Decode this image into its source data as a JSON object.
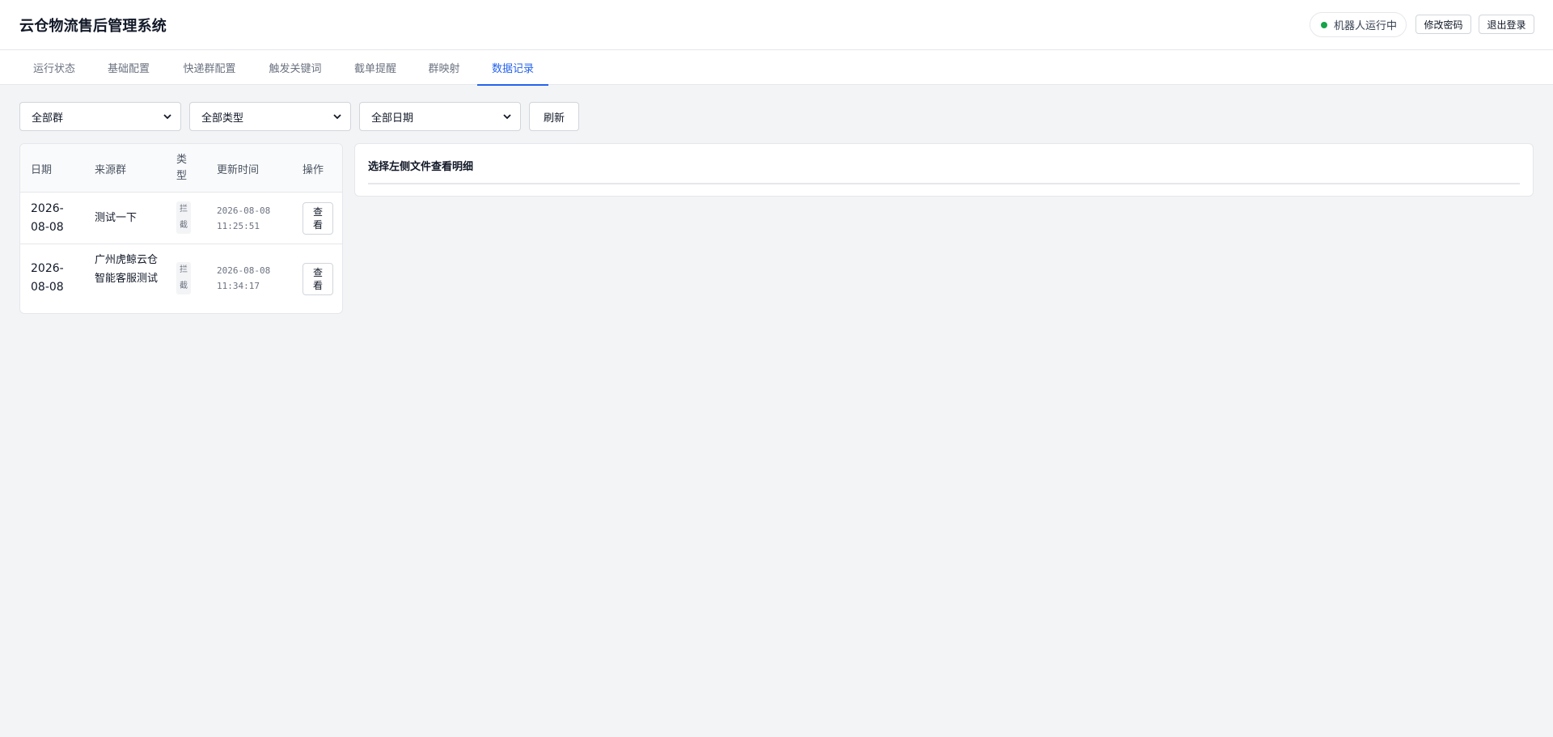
{
  "header": {
    "title": "云仓物流售后管理系统",
    "status": {
      "text": "机器人运行中",
      "color": "#16a34a"
    },
    "change_password_label": "修改密码",
    "logout_label": "退出登录"
  },
  "tabs": [
    {
      "label": "运行状态",
      "active": false
    },
    {
      "label": "基础配置",
      "active": false
    },
    {
      "label": "快递群配置",
      "active": false
    },
    {
      "label": "触发关键词",
      "active": false
    },
    {
      "label": "截单提醒",
      "active": false
    },
    {
      "label": "群映射",
      "active": false
    },
    {
      "label": "数据记录",
      "active": true
    }
  ],
  "filters": {
    "group": {
      "selected": "全部群"
    },
    "type": {
      "selected": "全部类型"
    },
    "date": {
      "selected": "全部日期"
    },
    "refresh_label": "刷新"
  },
  "records_table": {
    "columns": [
      "日期",
      "来源群",
      "类型",
      "更新时间",
      "操作"
    ],
    "rows": [
      {
        "date": "2026-08-08",
        "source_group": "测试一下",
        "type": "拦截",
        "updated_time": "2026-08-08 11:25:51",
        "action_label": "查看"
      },
      {
        "date": "2026-08-08",
        "source_group": "广州虎鲸云仓智能客服测试",
        "type": "拦截",
        "updated_time": "2026-08-08 11:34:17",
        "action_label": "查看"
      }
    ]
  },
  "detail_panel": {
    "title": "选择左侧文件查看明细"
  },
  "colors": {
    "accent": "#2563eb",
    "page_bg": "#f3f4f6",
    "status_green": "#16a34a"
  }
}
